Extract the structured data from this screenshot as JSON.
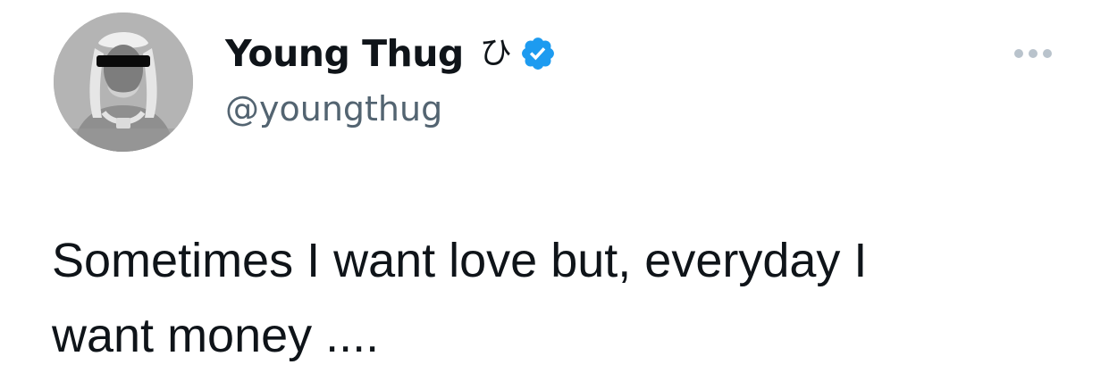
{
  "tweet": {
    "author": {
      "display_name": "Young Thug",
      "name_glyph": "ひ",
      "handle": "@youngthug",
      "verified": true,
      "avatar_icon": "avatar-image"
    },
    "text": "Sometimes I want love but, everyday I\nwant money ....",
    "more_icon": "more-options-icon"
  },
  "colors": {
    "text": "#0f1419",
    "secondary_text": "#536471",
    "verified_blue": "#1d9bf0",
    "background": "#ffffff",
    "more_icon": "#b9c3cc"
  }
}
